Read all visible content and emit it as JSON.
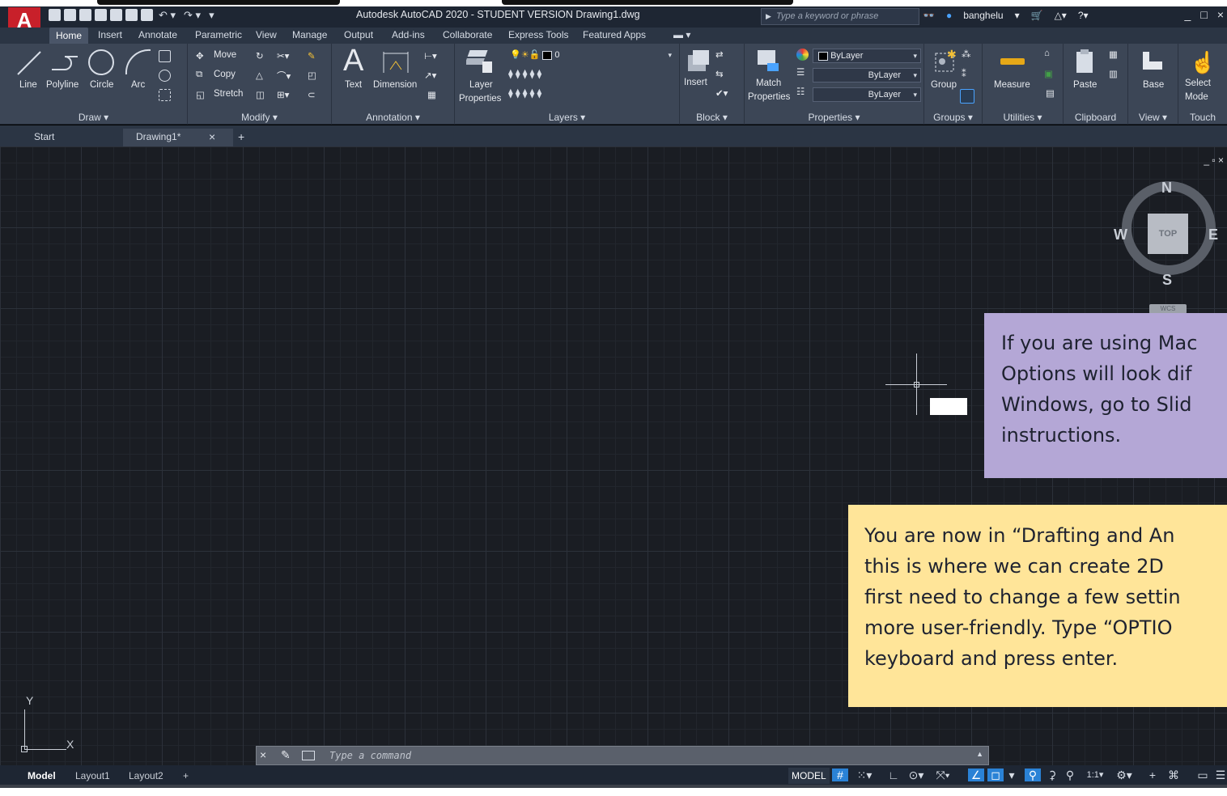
{
  "app": {
    "title": "Autodesk AutoCAD 2020 - STUDENT VERSION    Drawing1.dwg",
    "logo_letter": "A",
    "search_placeholder": "Type a keyword or phrase",
    "username": "banghelu",
    "window_controls": [
      "_",
      "□",
      "×"
    ]
  },
  "ribbon_tabs": [
    "Home",
    "Insert",
    "Annotate",
    "Parametric",
    "View",
    "Manage",
    "Output",
    "Add-ins",
    "Collaborate",
    "Express Tools",
    "Featured Apps"
  ],
  "panels": {
    "draw": {
      "title": "Draw ▾",
      "tools": [
        "Line",
        "Polyline",
        "Circle",
        "Arc"
      ]
    },
    "modify": {
      "title": "Modify ▾",
      "tools": [
        "Move",
        "Copy",
        "Stretch"
      ]
    },
    "annotation": {
      "title": "Annotation ▾",
      "tools": [
        "Text",
        "Dimension"
      ]
    },
    "layers": {
      "title": "Layers ▾",
      "tool_line1": "Layer",
      "tool_line2": "Properties",
      "current_layer": "0"
    },
    "block": {
      "title": "Block ▾",
      "tool": "Insert"
    },
    "properties": {
      "title": "Properties ▾",
      "tool_line1": "Match",
      "tool_line2": "Properties",
      "color": "ByLayer",
      "linetype": "ByLayer",
      "lineweight": "ByLayer"
    },
    "groups": {
      "title": "Groups ▾",
      "tool": "Group"
    },
    "utilities": {
      "title": "Utilities ▾",
      "tool": "Measure"
    },
    "clipboard": {
      "title": "Clipboard",
      "tool": "Paste"
    },
    "view": {
      "title": "View ▾",
      "tool": "Base"
    },
    "touch": {
      "title": "Touch",
      "tool_line1": "Select",
      "tool_line2": "Mode"
    }
  },
  "file_tabs": {
    "start": "Start",
    "drawing": "Drawing1*",
    "close": "×",
    "add": "+"
  },
  "viewport": {
    "controls": "_ ▫ ×",
    "viewcube": {
      "n": "N",
      "s": "S",
      "e": "E",
      "w": "W",
      "face": "TOP",
      "wcs": "WCS"
    },
    "ucs": {
      "x": "X",
      "y": "Y"
    }
  },
  "notes": {
    "purple": "If you are using Mac\nOptions will look dif\nWindows, go to Slid\ninstructions.",
    "yellow": "You are now in “Drafting and An\nthis is where we can create 2D \nfirst need to change a few settin\nmore user-friendly. Type “OPTIO\nkeyboard and press enter."
  },
  "command_line": {
    "placeholder": "Type a command",
    "close": "×",
    "wrench": "✎"
  },
  "layout_tabs": [
    "Model",
    "Layout1",
    "Layout2",
    "+"
  ],
  "status": {
    "model": "MODEL",
    "scale": "1:1"
  },
  "colors": {
    "background": "#1a1d23",
    "ribbon": "#3c4656",
    "titlebar": "#1e2633",
    "accent": "#2a82d6",
    "note_purple": "#b4a7d6",
    "note_yellow": "#ffe599",
    "logo_red": "#c8202a"
  }
}
